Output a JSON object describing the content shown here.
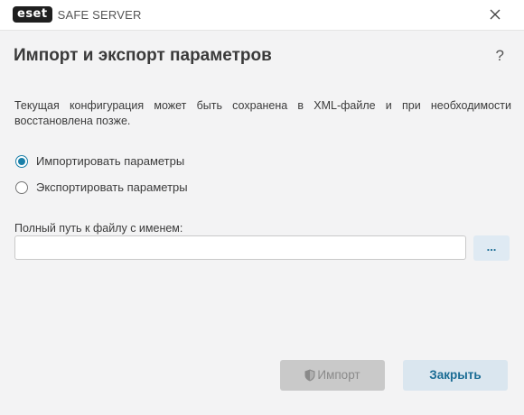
{
  "app": {
    "logo_text": "eset",
    "product_name": "SAFE SERVER"
  },
  "dialog": {
    "title": "Импорт и экспорт параметров",
    "help_label": "?",
    "description": "Текущая конфигурация может быть сохранена в XML-файле и при необходимости восстановлена позже.",
    "options": [
      {
        "label": "Импортировать параметры",
        "checked": true
      },
      {
        "label": "Экспортировать параметры",
        "checked": false
      }
    ],
    "path_label": "Полный путь к файлу с именем:",
    "path_value": "",
    "browse_label": "...",
    "import_button": "Импорт",
    "close_button": "Закрыть"
  },
  "colors": {
    "accent": "#1a7fa8",
    "background": "#f3f3f4",
    "disabled_button": "#c9c9c9",
    "close_button_bg": "#dae6ef"
  }
}
